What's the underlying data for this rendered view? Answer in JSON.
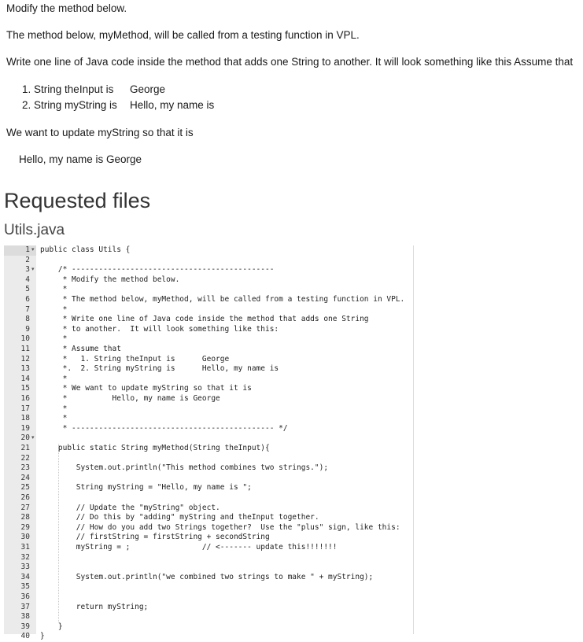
{
  "description": {
    "p1": "Modify the method below.",
    "p2": "The method below, myMethod, will be called from a testing function in VPL.",
    "p3": "Write one line of Java code inside the method that adds one String to another.  It will look something like this Assume that",
    "list": [
      {
        "num": "1.",
        "label": "String theInput is",
        "value": "George"
      },
      {
        "num": "2.",
        "label": "String myString is",
        "value": "Hello, my name is"
      }
    ],
    "p4": "We want to update myString so that it is",
    "p5": "Hello, my name is George"
  },
  "files": {
    "heading": "Requested files",
    "filename": "Utils.java"
  },
  "editor": {
    "folds": [
      "1",
      "3",
      "20"
    ],
    "lines": [
      "public class Utils {",
      "",
      "    /* ---------------------------------------------",
      "     * Modify the method below.",
      "     *",
      "     * The method below, myMethod, will be called from a testing function in VPL.",
      "     *",
      "     * Write one line of Java code inside the method that adds one String",
      "     * to another.  It will look something like this:",
      "     *",
      "     * Assume that",
      "     *   1. String theInput is      George",
      "     *.  2. String myString is      Hello, my name is",
      "     *",
      "     * We want to update myString so that it is",
      "     *          Hello, my name is George",
      "     *",
      "     *",
      "     * --------------------------------------------- */",
      "",
      "    public static String myMethod(String theInput){",
      "",
      "        System.out.println(\"This method combines two strings.\");",
      "",
      "        String myString = \"Hello, my name is \";",
      "",
      "        // Update the \"myString\" object.",
      "        // Do this by \"adding\" myString and theInput together.",
      "        // How do you add two Strings together?  Use the \"plus\" sign, like this:",
      "        // firstString = firstString + secondString",
      "        myString = ;                // <------- update this!!!!!!!",
      "",
      "",
      "        System.out.println(\"we combined two strings to make \" + myString);",
      "",
      "",
      "        return myString;",
      "",
      "    }",
      "}"
    ]
  }
}
